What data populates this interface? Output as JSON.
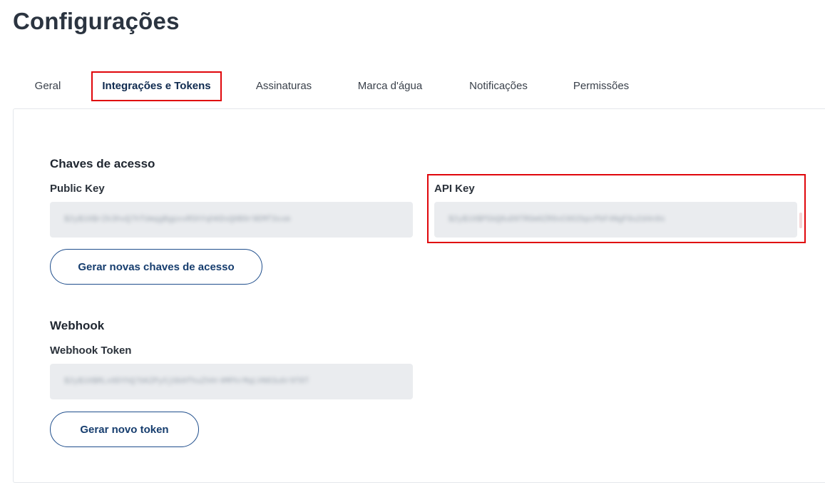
{
  "page": {
    "title": "Configurações"
  },
  "tabs": [
    {
      "label": "Geral",
      "active": false
    },
    {
      "label": "Integrações e Tokens",
      "active": true
    },
    {
      "label": "Assinaturas",
      "active": false
    },
    {
      "label": "Marca d'água",
      "active": false
    },
    {
      "label": "Notificações",
      "active": false
    },
    {
      "label": "Permissões",
      "active": false
    }
  ],
  "access_keys": {
    "section_title": "Chaves de acesso",
    "public_key": {
      "label": "Public Key",
      "value": "$2y$10$rZk3hvQ7hTUmqgBgpxvR5hYqhKDsQ0B9r9EMf3sxm"
    },
    "api_key": {
      "label": "API Key",
      "value": "$2y$10$P5bQ8uD9TRGm0ZR9xC0O2bpcPbF4NgF0u2d4n9s"
    },
    "generate_button_label": "Gerar novas chaves de acesso"
  },
  "webhook": {
    "section_title": "Webhook",
    "token": {
      "label": "Webhook Token",
      "value": "$2y$10$RLx0DYhQ7bKZPy5jGb0fhuZhHr4MPhrMqLVN83u6r9T8T"
    },
    "generate_button_label": "Gerar novo token"
  },
  "colors": {
    "highlight": "#e0060b",
    "button_border": "#1f4e8c",
    "field_background": "#eaecef"
  }
}
